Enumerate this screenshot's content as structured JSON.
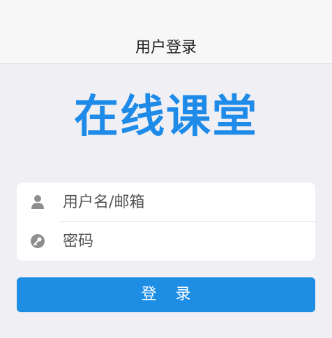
{
  "header": {
    "title": "用户登录"
  },
  "logo": {
    "text": "在线课堂"
  },
  "form": {
    "username": {
      "placeholder": "用户名/邮箱",
      "value": "",
      "icon": "user-icon"
    },
    "password": {
      "placeholder": "密码",
      "value": "",
      "icon": "key-icon"
    }
  },
  "login_button": {
    "label": "登 录"
  },
  "colors": {
    "accent": "#1e8ee5",
    "logo": "#1f8be8",
    "background": "#efeff4",
    "nav_background": "#f7f7f7"
  }
}
